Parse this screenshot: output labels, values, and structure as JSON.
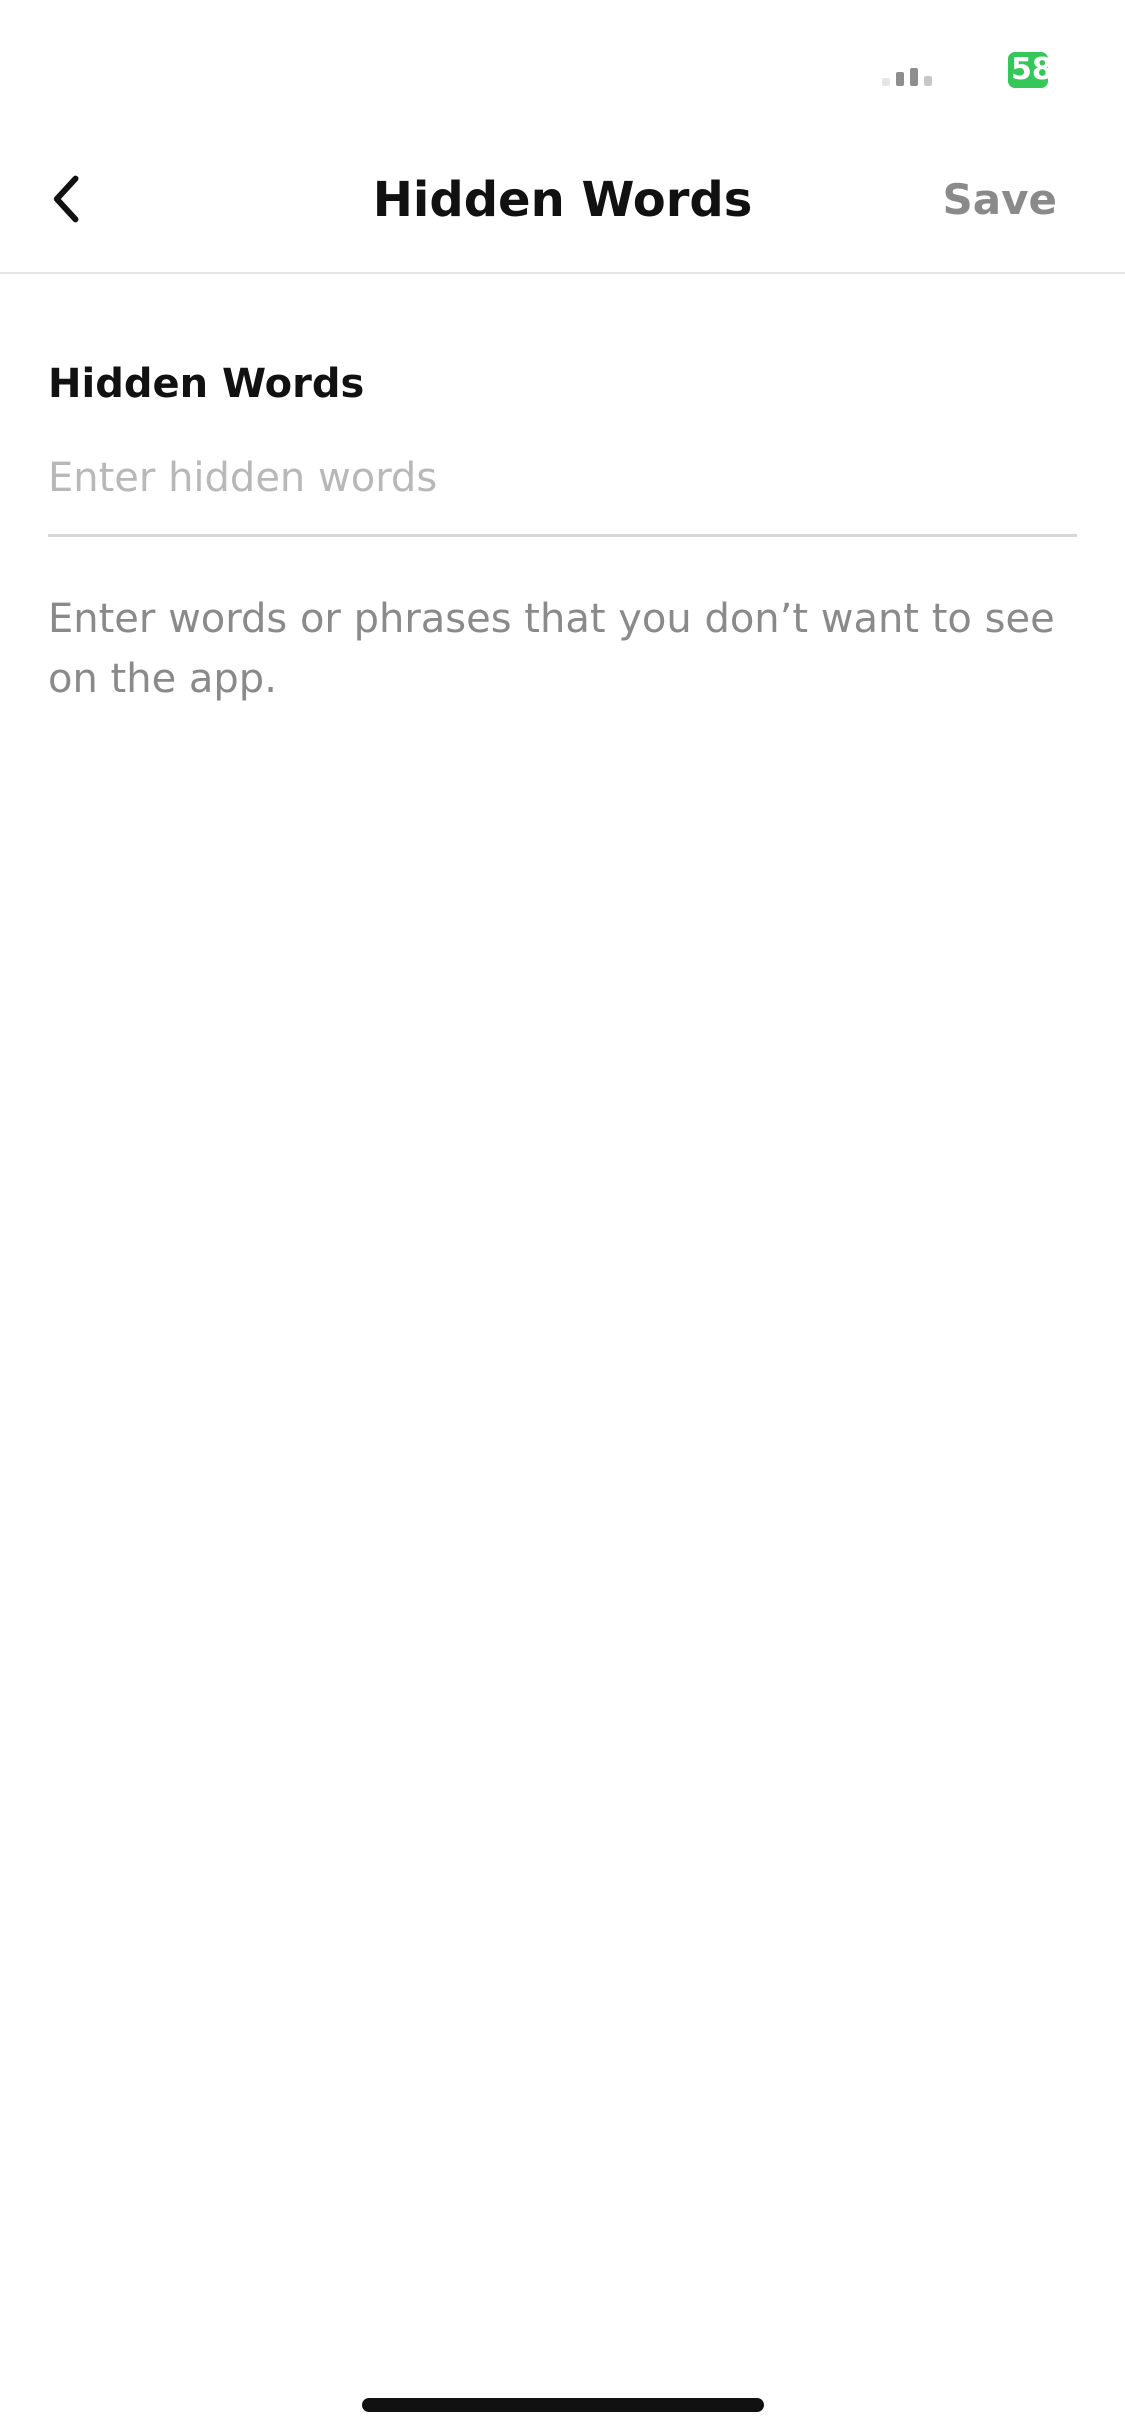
{
  "status_bar": {
    "battery_level": "58",
    "battery_color": "#34c759"
  },
  "nav": {
    "back_icon": "chevron-left-icon",
    "title": "Hidden Words",
    "save_label": "Save"
  },
  "form": {
    "label": "Hidden Words",
    "input_value": "",
    "input_placeholder": "Enter hidden words",
    "help_text": "Enter words or phrases that you don’t want to see on the app."
  },
  "colors": {
    "title_text": "#111111",
    "disabled_action": "#8a8a8a",
    "placeholder": "#b8b8b8",
    "divider": "#d8d8d8"
  }
}
